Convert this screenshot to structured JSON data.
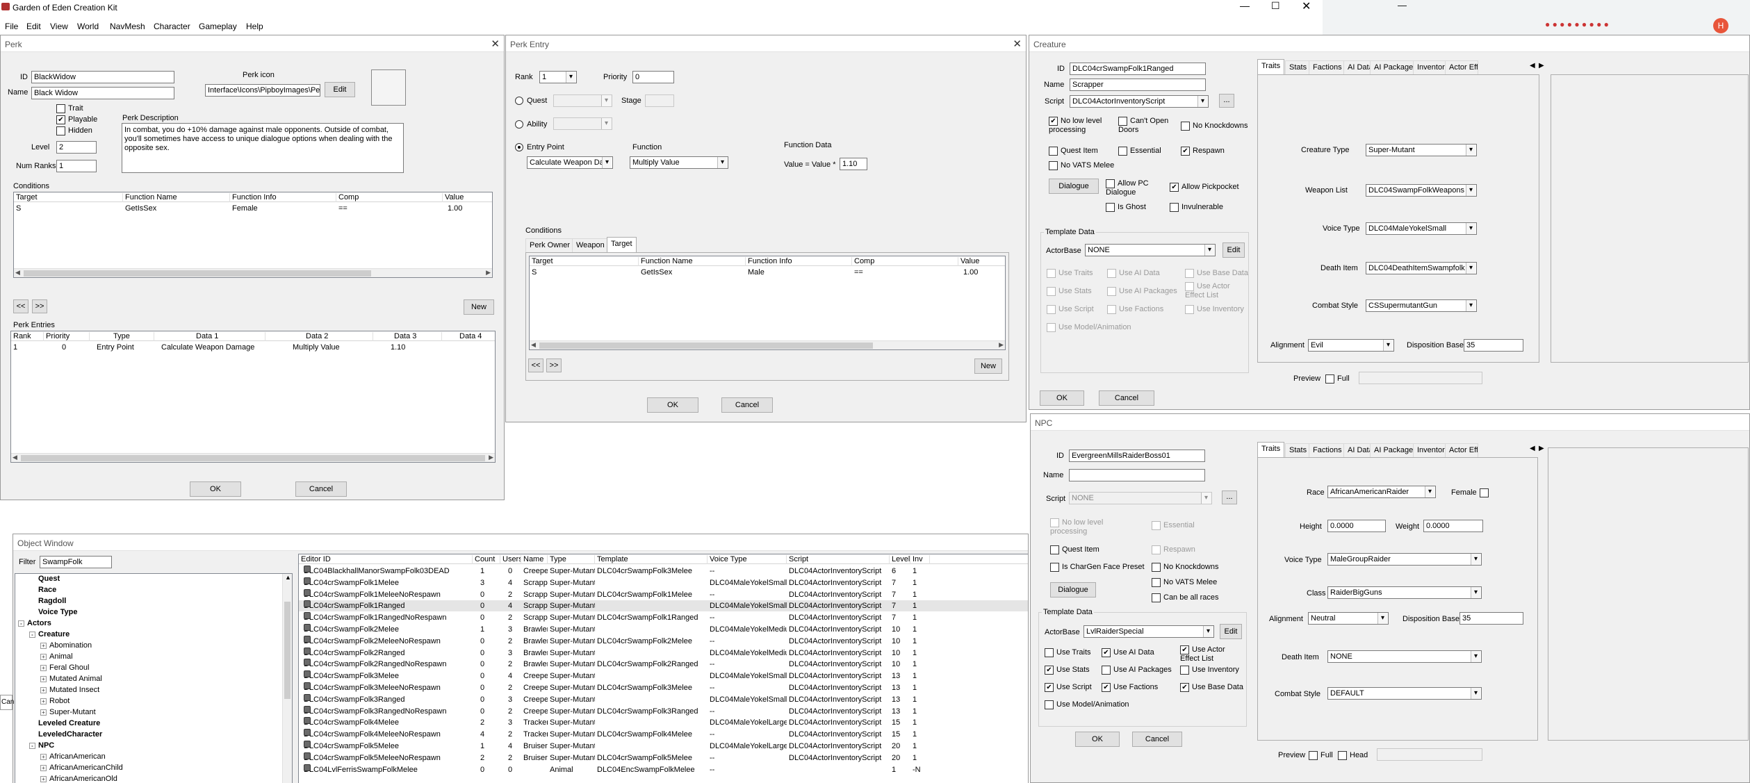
{
  "app": {
    "title": "Garden of Eden Creation Kit",
    "menu": [
      "File",
      "Edit",
      "View",
      "World",
      "NavMesh",
      "Character",
      "Gameplay",
      "Help"
    ]
  },
  "perk": {
    "title": "Perk",
    "id_label": "ID",
    "id": "BlackWidow",
    "name_label": "Name",
    "name": "Black Widow",
    "icon_label": "Perk icon",
    "icon_path": "Interface\\Icons\\PipboyImages\\Pe",
    "edit": "Edit",
    "trait": "Trait",
    "playable": "Playable",
    "hidden": "Hidden",
    "desc_label": "Perk Description",
    "description": "In combat, you do +10% damage against male opponents. Outside of combat, you'll sometimes have access to unique dialogue options when dealing with the opposite sex.",
    "level_label": "Level",
    "level": "2",
    "numranks_label": "Num Ranks",
    "numranks": "1",
    "conditions_label": "Conditions",
    "cond_headers": [
      "Target",
      "Function Name",
      "Function Info",
      "Comp",
      "Value"
    ],
    "cond_rows": [
      [
        "S",
        "GetIsSex",
        "Female",
        "==",
        "1.00"
      ]
    ],
    "prev": "<<",
    "next": ">>",
    "new": "New",
    "entries_label": "Perk Entries",
    "entry_headers": [
      "Rank",
      "Priority",
      "Type",
      "Data 1",
      "Data 2",
      "Data 3",
      "Data 4"
    ],
    "entry_rows": [
      [
        "1",
        "0",
        "Entry Point",
        "Calculate Weapon Damage",
        "Multiply Value",
        "1.10",
        ""
      ]
    ],
    "ok": "OK",
    "cancel": "Cancel"
  },
  "perk_entry": {
    "title": "Perk Entry",
    "rank_label": "Rank",
    "rank": "1",
    "priority_label": "Priority",
    "priority": "0",
    "quest": "Quest",
    "stage": "Stage",
    "ability": "Ability",
    "entry_point": "Entry Point",
    "entry_point_value": "Calculate Weapon Da",
    "function_label": "Function",
    "function_value": "Multiply Value",
    "function_data_label": "Function Data",
    "value_expr": "Value = Value *",
    "value": "1.10",
    "conditions_label": "Conditions",
    "tabs": [
      "Perk Owner",
      "Weapon",
      "Target"
    ],
    "cond_headers": [
      "Target",
      "Function Name",
      "Function Info",
      "Comp",
      "Value"
    ],
    "cond_rows": [
      [
        "S",
        "GetIsSex",
        "Male",
        "==",
        "1.00"
      ]
    ],
    "prev": "<<",
    "next": ">>",
    "new": "New",
    "ok": "OK",
    "cancel": "Cancel"
  },
  "creature": {
    "title": "Creature",
    "id_label": "ID",
    "id": "DLC04crSwampFolk1Ranged",
    "name_label": "Name",
    "name": "Scrapper",
    "script_label": "Script",
    "script": "DLC04ActorInventoryScript",
    "dots": "...",
    "no_low_level": "No low level processing",
    "cant_open_doors": "Can't Open Doors",
    "no_knockdowns": "No Knockdowns",
    "quest_item": "Quest Item",
    "essential": "Essential",
    "respawn": "Respawn",
    "no_vats": "No VATS Melee",
    "dialogue": "Dialogue",
    "allow_pc_dialogue": "Allow PC Dialogue",
    "allow_pickpocket": "Allow Pickpocket",
    "is_ghost": "Is Ghost",
    "invulnerable": "Invulnerable",
    "template_label": "Template Data",
    "actorbase_label": "ActorBase",
    "actorbase": "NONE",
    "edit": "Edit",
    "use": [
      "Use Traits",
      "Use AI Data",
      "Use Base Data",
      "Use Stats",
      "Use AI Packages",
      "Use Actor Effect List",
      "Use Script",
      "Use Factions",
      "Use Inventory",
      "Use Model/Animation"
    ],
    "tabs": [
      "Traits",
      "Stats",
      "Factions",
      "AI Data",
      "AI Packages",
      "Inventory",
      "Actor Effe"
    ],
    "creature_type_label": "Creature Type",
    "creature_type": "Super-Mutant",
    "weapon_list_label": "Weapon List",
    "weapon_list": "DLC04SwampFolkWeapons",
    "voice_type_label": "Voice Type",
    "voice_type": "DLC04MaleYokelSmall",
    "death_item_label": "Death Item",
    "death_item": "DLC04DeathItemSwampfolk",
    "combat_style_label": "Combat Style",
    "combat_style": "CSSupermutantGun",
    "alignment_label": "Alignment",
    "alignment": "Evil",
    "disposition_label": "Disposition Base",
    "disposition": "35",
    "preview": "Preview",
    "full": "Full",
    "ok": "OK",
    "cancel": "Cancel"
  },
  "npc": {
    "title": "NPC",
    "id_label": "ID",
    "id": "EvergreenMillsRaiderBoss01",
    "name_label": "Name",
    "name": "",
    "script_label": "Script",
    "script": "NONE",
    "dots": "...",
    "no_low_level": "No low level processing",
    "essential": "Essential",
    "quest_item": "Quest Item",
    "respawn": "Respawn",
    "chargen": "Is CharGen Face Preset",
    "no_knockdowns": "No Knockdowns",
    "no_vats": "No VATS Melee",
    "dialogue": "Dialogue",
    "can_be_all_races": "Can be all races",
    "template_label": "Template Data",
    "actorbase_label": "ActorBase",
    "actorbase": "LvlRaiderSpecial",
    "edit": "Edit",
    "use": [
      "Use Traits",
      "Use AI Data",
      "Use Actor Effect List",
      "Use Stats",
      "Use AI Packages",
      "Use Inventory",
      "Use Script",
      "Use Factions",
      "Use Base Data",
      "Use Model/Animation"
    ],
    "tabs": [
      "Traits",
      "Stats",
      "Factions",
      "AI Data",
      "AI Packages",
      "Inventory",
      "Actor Effe"
    ],
    "race_label": "Race",
    "race": "AfricanAmericanRaider",
    "female": "Female",
    "height_label": "Height",
    "height": "0.0000",
    "weight_label": "Weight",
    "weight": "0.0000",
    "voice_type_label": "Voice Type",
    "voice_type": "MaleGroupRaider",
    "class_label": "Class",
    "class_value": "RaiderBigGuns",
    "alignment_label": "Alignment",
    "alignment": "Neutral",
    "disposition_label": "Disposition Base",
    "disposition": "35",
    "death_item_label": "Death Item",
    "death_item": "NONE",
    "combat_style_label": "Combat Style",
    "combat_style": "DEFAULT",
    "preview": "Preview",
    "full": "Full",
    "head": "Head",
    "ok": "OK",
    "cancel": "Cancel"
  },
  "object_window": {
    "title": "Object Window",
    "filter_label": "Filter",
    "filter": "SwampFolk",
    "tree": [
      {
        "label": "Quest",
        "level": 1,
        "bold": true
      },
      {
        "label": "Race",
        "level": 1,
        "bold": true
      },
      {
        "label": "Ragdoll",
        "level": 1,
        "bold": true
      },
      {
        "label": "Voice Type",
        "level": 1,
        "bold": true
      },
      {
        "label": "Actors",
        "level": 0,
        "bold": true,
        "pm": "-"
      },
      {
        "label": "Creature",
        "level": 1,
        "bold": true,
        "pm": "-"
      },
      {
        "label": "Abomination",
        "level": 2,
        "pm": "+"
      },
      {
        "label": "Animal",
        "level": 2,
        "pm": "+"
      },
      {
        "label": "Feral Ghoul",
        "level": 2,
        "pm": "+"
      },
      {
        "label": "Mutated Animal",
        "level": 2,
        "pm": "+"
      },
      {
        "label": "Mutated Insect",
        "level": 2,
        "pm": "+"
      },
      {
        "label": "Robot",
        "level": 2,
        "pm": "+"
      },
      {
        "label": "Super-Mutant",
        "level": 2,
        "pm": "+"
      },
      {
        "label": "Leveled Creature",
        "level": 1,
        "bold": true
      },
      {
        "label": "LeveledCharacter",
        "level": 1,
        "bold": true
      },
      {
        "label": "NPC",
        "level": 1,
        "bold": true,
        "pm": "-"
      },
      {
        "label": "AfricanAmerican",
        "level": 2,
        "pm": "+"
      },
      {
        "label": "AfricanAmericanChild",
        "level": 2,
        "pm": "+"
      },
      {
        "label": "AfricanAmericanOld",
        "level": 2,
        "pm": "+"
      }
    ],
    "headers": [
      "Editor ID",
      "Count",
      "Users",
      "Name",
      "Type",
      "Template",
      "Voice Type",
      "Script",
      "Level",
      "Inv"
    ],
    "rows": [
      [
        "DLC04BlackhallManorSwampFolk03DEAD",
        "1",
        "0",
        "Creeper",
        "Super-Mutant",
        "DLC04crSwampFolk3Melee",
        "--",
        "DLC04ActorInventoryScript",
        "6",
        "1"
      ],
      [
        "DLC04crSwampFolk1Melee",
        "3",
        "4",
        "Scrapper",
        "Super-Mutant",
        "",
        "DLC04MaleYokelSmall",
        "DLC04ActorInventoryScript",
        "7",
        "1"
      ],
      [
        "DLC04crSwampFolk1MeleeNoRespawn",
        "0",
        "2",
        "Scrapper",
        "Super-Mutant",
        "DLC04crSwampFolk1Melee",
        "--",
        "DLC04ActorInventoryScript",
        "7",
        "1"
      ],
      [
        "DLC04crSwampFolk1Ranged",
        "0",
        "4",
        "Scrapper",
        "Super-Mutant",
        "",
        "DLC04MaleYokelSmall",
        "DLC04ActorInventoryScript",
        "7",
        "1"
      ],
      [
        "DLC04crSwampFolk1RangedNoRespawn",
        "0",
        "2",
        "Scrapper",
        "Super-Mutant",
        "DLC04crSwampFolk1Ranged",
        "--",
        "DLC04ActorInventoryScript",
        "7",
        "1"
      ],
      [
        "DLC04crSwampFolk2Melee",
        "1",
        "3",
        "Brawler",
        "Super-Mutant",
        "",
        "DLC04MaleYokelMedium",
        "DLC04ActorInventoryScript",
        "10",
        "1"
      ],
      [
        "DLC04crSwampFolk2MeleeNoRespawn",
        "0",
        "2",
        "Brawler",
        "Super-Mutant",
        "DLC04crSwampFolk2Melee",
        "--",
        "DLC04ActorInventoryScript",
        "10",
        "1"
      ],
      [
        "DLC04crSwampFolk2Ranged",
        "0",
        "3",
        "Brawler",
        "Super-Mutant",
        "",
        "DLC04MaleYokelMedium",
        "DLC04ActorInventoryScript",
        "10",
        "1"
      ],
      [
        "DLC04crSwampFolk2RangedNoRespawn",
        "0",
        "2",
        "Brawler",
        "Super-Mutant",
        "DLC04crSwampFolk2Ranged",
        "--",
        "DLC04ActorInventoryScript",
        "10",
        "1"
      ],
      [
        "DLC04crSwampFolk3Melee",
        "0",
        "4",
        "Creeper",
        "Super-Mutant",
        "",
        "DLC04MaleYokelSmall",
        "DLC04ActorInventoryScript",
        "13",
        "1"
      ],
      [
        "DLC04crSwampFolk3MeleeNoRespawn",
        "0",
        "2",
        "Creeper",
        "Super-Mutant",
        "DLC04crSwampFolk3Melee",
        "--",
        "DLC04ActorInventoryScript",
        "13",
        "1"
      ],
      [
        "DLC04crSwampFolk3Ranged",
        "0",
        "3",
        "Creeper",
        "Super-Mutant",
        "",
        "DLC04MaleYokelSmall",
        "DLC04ActorInventoryScript",
        "13",
        "1"
      ],
      [
        "DLC04crSwampFolk3RangedNoRespawn",
        "0",
        "2",
        "Creeper",
        "Super-Mutant",
        "DLC04crSwampFolk3Ranged",
        "--",
        "DLC04ActorInventoryScript",
        "13",
        "1"
      ],
      [
        "DLC04crSwampFolk4Melee",
        "2",
        "3",
        "Tracker",
        "Super-Mutant",
        "",
        "DLC04MaleYokelLarge",
        "DLC04ActorInventoryScript",
        "15",
        "1"
      ],
      [
        "DLC04crSwampFolk4MeleeNoRespawn",
        "4",
        "2",
        "Tracker",
        "Super-Mutant",
        "DLC04crSwampFolk4Melee",
        "--",
        "DLC04ActorInventoryScript",
        "15",
        "1"
      ],
      [
        "DLC04crSwampFolk5Melee",
        "1",
        "4",
        "Bruiser",
        "Super-Mutant",
        "",
        "DLC04MaleYokelLarge",
        "DLC04ActorInventoryScript",
        "20",
        "1"
      ],
      [
        "DLC04crSwampFolk5MeleeNoRespawn",
        "2",
        "2",
        "Bruiser",
        "Super-Mutant",
        "DLC04crSwampFolk5Melee",
        "--",
        "DLC04ActorInventoryScript",
        "20",
        "1"
      ],
      [
        "DLC04LvlFerrisSwampFolkMelee",
        "0",
        "0",
        "",
        "Animal",
        "DLC04EncSwampFolkMelee",
        "--",
        "",
        "1",
        "-N"
      ]
    ]
  }
}
